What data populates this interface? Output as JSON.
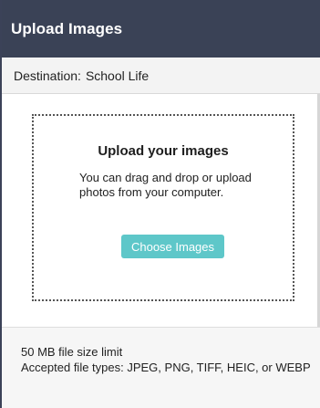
{
  "header": {
    "title": "Upload Images"
  },
  "destination": {
    "label": "Destination:",
    "value": "School Life"
  },
  "drop_zone": {
    "title": "Upload your images",
    "description": "You can drag and drop or upload photos from your computer.",
    "button_label": "Choose Images"
  },
  "footer": {
    "size_limit": "50 MB file size limit",
    "accepted_types": "Accepted file types: JPEG, PNG, TIFF, HEIC, or WEBP"
  },
  "colors": {
    "header_bg": "#3a4256",
    "button_bg": "#5ec7c9"
  }
}
